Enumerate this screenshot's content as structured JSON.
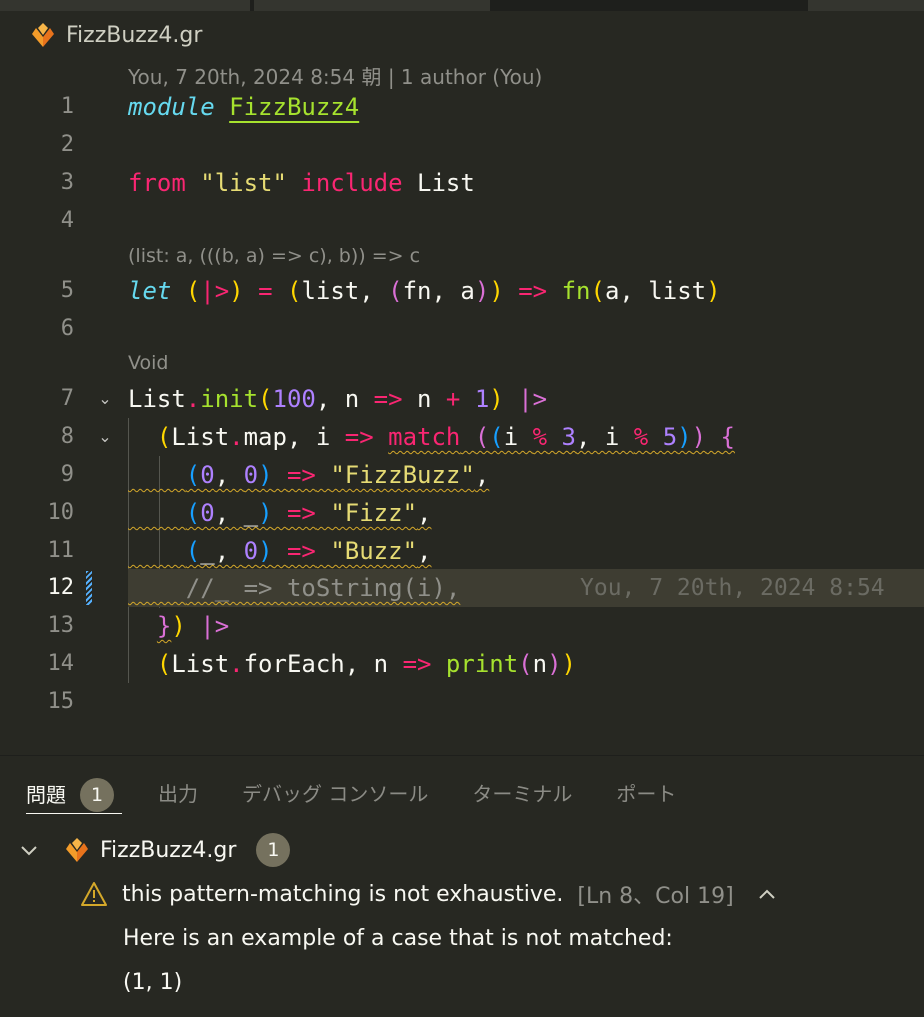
{
  "breadcrumb": {
    "file": "FizzBuzz4.gr"
  },
  "editor": {
    "blame_header": "You, 7 20th, 2024 8:54 朝 | 1 author (You)",
    "hint_line5": "(list: a, (((b, a) => c), b)) => c",
    "hint_line7": "Void",
    "inline_blame": "You, 7 20th, 2024 8:54",
    "line_numbers": [
      "1",
      "2",
      "3",
      "4",
      "5",
      "6",
      "7",
      "8",
      "9",
      "10",
      "11",
      "12",
      "13",
      "14",
      "15"
    ],
    "fold_chevron": "⌄",
    "tokens": {
      "l1": [
        "module",
        " ",
        "FizzBuzz4"
      ],
      "l3": [
        "from",
        " ",
        "\"list\"",
        " ",
        "include",
        " ",
        "List"
      ],
      "l5": [
        "let",
        " ",
        "(",
        "|>",
        ")",
        " = ",
        "(",
        "list",
        ", ",
        "(",
        "fn",
        ", ",
        "a",
        ")",
        ")",
        " ",
        "=>",
        " ",
        "fn",
        "(",
        "a",
        ", ",
        "list",
        ")"
      ],
      "l7": [
        "List",
        ".",
        "init",
        "(",
        "100",
        ", n ",
        "=>",
        " n ",
        "+",
        " ",
        "1",
        ")",
        " ",
        "|>"
      ],
      "l8": [
        "(",
        "List",
        ".",
        "map",
        ", i ",
        "=>",
        " ",
        "match",
        " ",
        "(",
        "(",
        "i ",
        "%",
        " ",
        "3",
        ", i ",
        "%",
        " ",
        "5",
        ")",
        ")",
        " ",
        "{"
      ],
      "l9": [
        "(",
        "0",
        ", ",
        "0",
        ")",
        " ",
        "=>",
        " ",
        "\"FizzBuzz\"",
        ","
      ],
      "l10": [
        "(",
        "0",
        ", ",
        "_",
        ")",
        " ",
        "=>",
        " ",
        "\"Fizz\"",
        ","
      ],
      "l11": [
        "(",
        "_",
        ", ",
        "0",
        ")",
        " ",
        "=>",
        " ",
        "\"Buzz\"",
        ","
      ],
      "l12": [
        "//_ => toString(i),"
      ],
      "l13": [
        "}",
        ")",
        " ",
        "|>"
      ],
      "l14": [
        "(",
        "List",
        ".",
        "forEach",
        ", n ",
        "=>",
        " ",
        "print",
        "(",
        "n",
        ")",
        ")"
      ]
    }
  },
  "panel": {
    "tabs": [
      {
        "label": "問題",
        "count": "1"
      },
      {
        "label": "出力"
      },
      {
        "label": "デバッグ コンソール"
      },
      {
        "label": "ターミナル"
      },
      {
        "label": "ポート"
      }
    ],
    "file_group": {
      "label": "FizzBuzz4.gr",
      "count": "1"
    },
    "problem": {
      "message": "this pattern-matching is not exhaustive.",
      "location": "[Ln 8、Col 19]",
      "detail_1": "Here is an example of a case that is not matched:",
      "detail_2": "(1, 1)"
    }
  },
  "colors": {
    "background": "#272822",
    "keyword": "#f92672",
    "string": "#e6db74",
    "function": "#a6e22e",
    "number": "#ae81ff",
    "warning_squiggle": "#d4a82a",
    "logo_orange": "#f39c2a"
  },
  "icons": [
    "grain-logo-icon",
    "chevron-down-icon",
    "chevron-up-icon",
    "warning-icon"
  ]
}
